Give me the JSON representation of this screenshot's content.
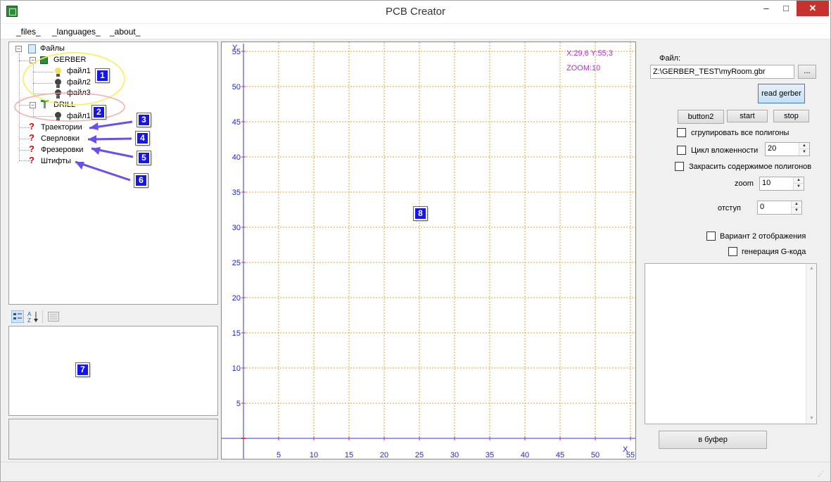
{
  "window": {
    "title": "PCB Creator",
    "minimize": "–",
    "maximize": "□",
    "close": "✕"
  },
  "menu": {
    "files": "_files_",
    "languages": "_languages_",
    "about": "_about_"
  },
  "tree": {
    "root": "Файлы",
    "gerber": {
      "label": "GERBER",
      "files": [
        "файл1",
        "файл2",
        "файл3"
      ]
    },
    "drill": {
      "label": "DRILL",
      "files": [
        "файл1"
      ]
    },
    "items": [
      "Траектории",
      "Сверловки",
      "Фрезеровки",
      "Штифты"
    ]
  },
  "badges": [
    "1",
    "2",
    "3",
    "4",
    "5",
    "6",
    "7",
    "8"
  ],
  "canvas": {
    "coords": "X:29,6 Y:55,3",
    "zoom": "ZOOM:10",
    "y_axis_label": "Y",
    "x_axis_label": "X",
    "y_ticks": [
      "55",
      "50",
      "45",
      "40",
      "35",
      "30",
      "25",
      "20",
      "15",
      "10",
      "5"
    ],
    "x_ticks": [
      "5",
      "10",
      "15",
      "20",
      "25",
      "30",
      "35",
      "40",
      "45",
      "50",
      "55"
    ],
    "colors": {
      "grid": "#e0a030",
      "axis": "#3333dd",
      "label": "#2222cc",
      "info": "#b030d0"
    }
  },
  "right": {
    "file_label": "Файл:",
    "file_path": "Z:\\GERBER_TEST\\myRoom.gbr",
    "browse": "...",
    "read_gerber": "read gerber",
    "button2": "button2",
    "start": "start",
    "stop": "stop",
    "group_polygons": "сгрупировать все полигоны",
    "nesting_cycle": "Цикл вложенности",
    "nesting_value": "20",
    "fill_polygons": "Закрасить содержимое полигонов",
    "zoom_label": "zoom",
    "zoom_value": "10",
    "offset_label": "отступ",
    "offset_value": "0",
    "variant2": "Вариант 2 отображения",
    "gcode": "генерация G-кода",
    "to_buffer": "в буфер"
  }
}
